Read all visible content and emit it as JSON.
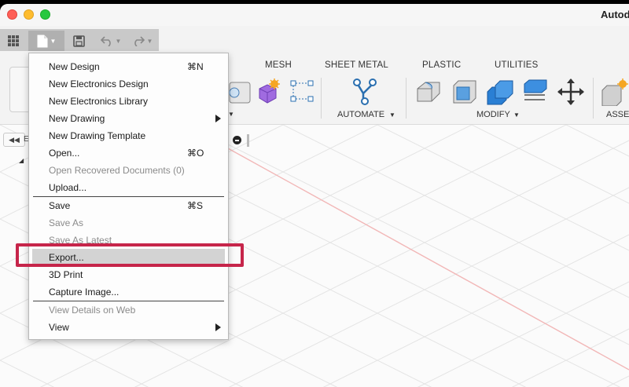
{
  "window": {
    "title": "Autod"
  },
  "quick_access": {
    "grid_icon": "grid-icon",
    "file_icon": "file-icon",
    "save_icon": "save-icon",
    "undo_icon": "undo-icon",
    "redo_icon": "redo-icon"
  },
  "ribbon": {
    "tabs": [
      "MESH",
      "SHEET METAL",
      "PLASTIC",
      "UTILITIES"
    ],
    "groups": {
      "automate": "AUTOMATE",
      "modify": "MODIFY",
      "assemble": "ASSEI"
    }
  },
  "file_menu": {
    "items": [
      {
        "label": "New Design",
        "shortcut": "⌘N"
      },
      {
        "label": "New Electronics Design"
      },
      {
        "label": "New Electronics Library"
      },
      {
        "label": "New Drawing"
      },
      {
        "label": "New Drawing Template"
      },
      {
        "label": "Open...",
        "shortcut": "⌘O"
      },
      {
        "label": "Open Recovered Documents (0)"
      },
      {
        "label": "Upload..."
      },
      {
        "label": "Save",
        "shortcut": "⌘S"
      },
      {
        "label": "Save As"
      },
      {
        "label": "Save As Latest"
      },
      {
        "label": "Export..."
      },
      {
        "label": "3D Print"
      },
      {
        "label": "Capture Image..."
      },
      {
        "label": "View Details on Web"
      },
      {
        "label": "View"
      }
    ]
  },
  "browser": {
    "letter": "E"
  },
  "colors": {
    "highlight_border": "#c6254a",
    "canvas_bg": "#fbfbfb",
    "menu_highlight": "#d3d3d3"
  }
}
